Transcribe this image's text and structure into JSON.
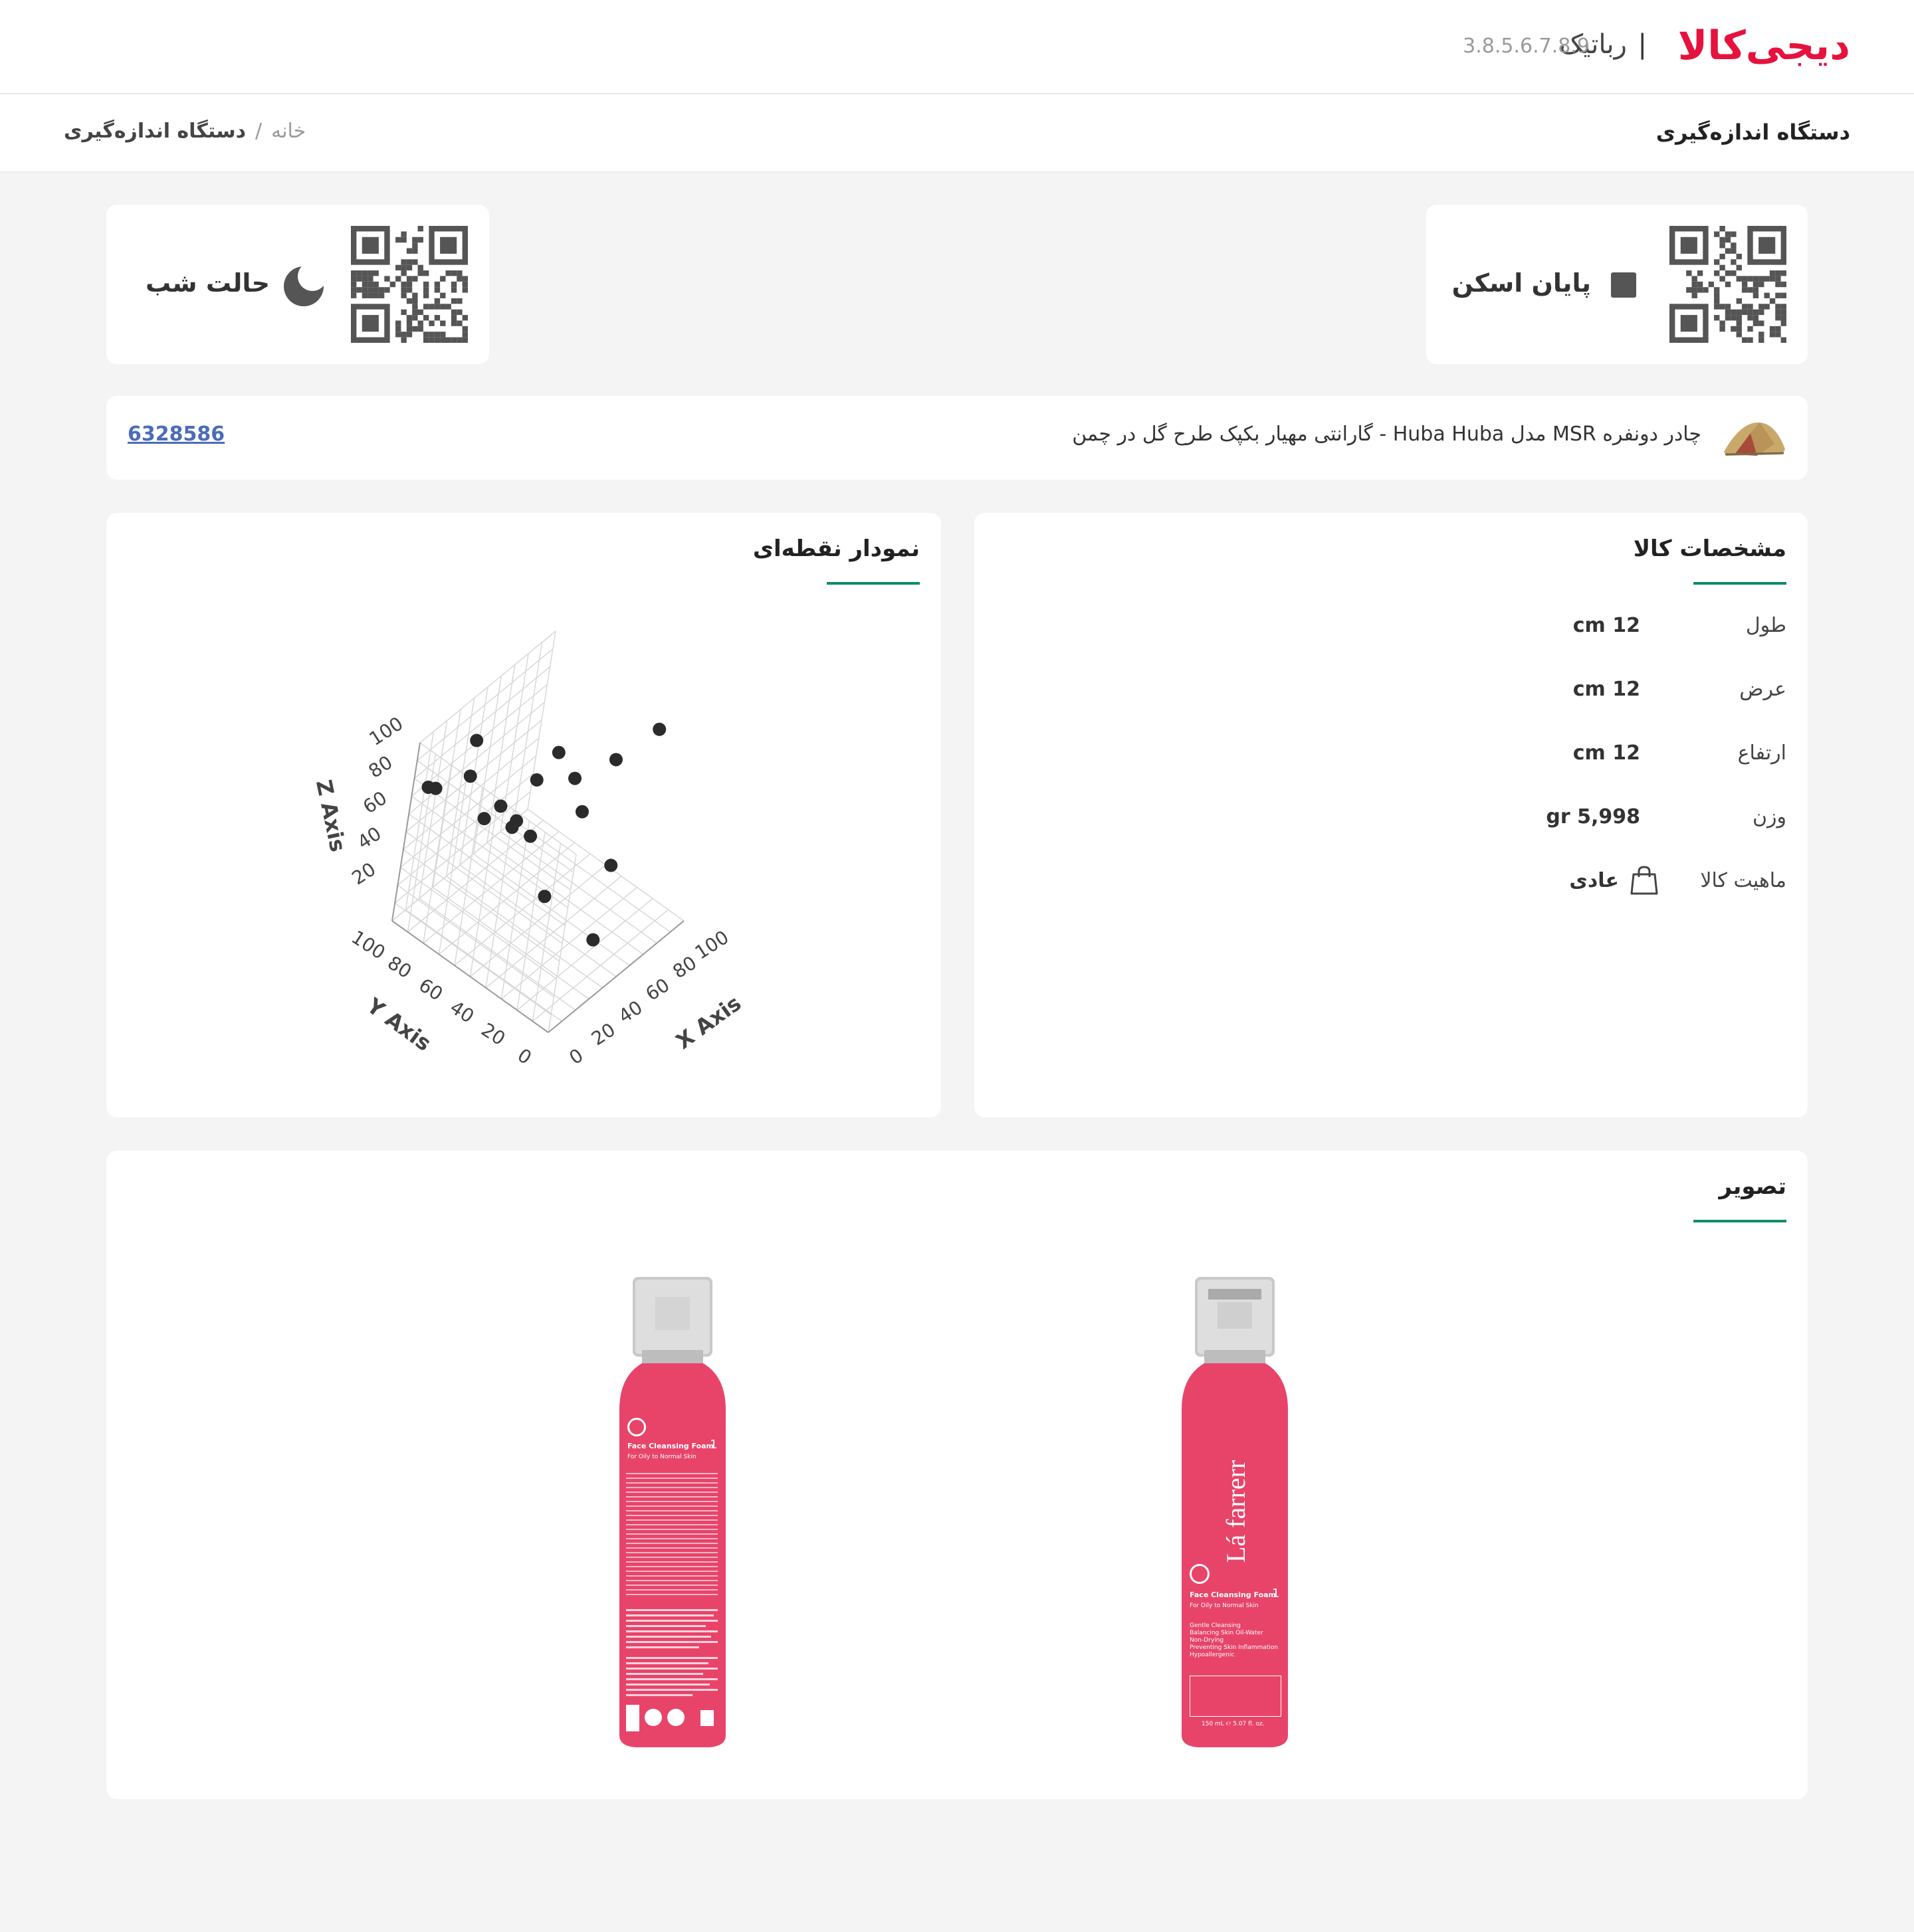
{
  "header": {
    "logo_text": "دیجی‌کالا",
    "separator": "|",
    "brand": "رباتیک",
    "version": "3.8.5.6.7.8.9"
  },
  "breadcrumb": {
    "page_title": "دستگاه اندازه‌گیری",
    "home": "خانه",
    "separator": "/",
    "current": "دستگاه اندازه‌گیری"
  },
  "actions": {
    "end_scan": "پایان اسکن",
    "night_mode": "حالت شب"
  },
  "product": {
    "title": "چادر دونفره MSR مدل Huba Huba - گارانتی مهیار بکپک طرح گل در چمن",
    "id": "6328586"
  },
  "specs": {
    "title": "مشخصات کالا",
    "rows": [
      {
        "label": "طول",
        "value": "12",
        "unit": "cm"
      },
      {
        "label": "عرض",
        "value": "12",
        "unit": "cm"
      },
      {
        "label": "ارتفاع",
        "value": "12",
        "unit": "cm"
      },
      {
        "label": "وزن",
        "value": "5,998",
        "unit": "gr"
      }
    ],
    "nature_label": "ماهیت کالا",
    "nature_value": "عادی"
  },
  "scatter": {
    "title": "نمودار نقطه‌ای"
  },
  "chart_data": {
    "type": "scatter",
    "title": "",
    "xlabel": "X Axis",
    "ylabel": "Y Axis",
    "zlabel": "Z Axis",
    "xlim": [
      0,
      100
    ],
    "ylim": [
      0,
      100
    ],
    "zlim": [
      0,
      100
    ],
    "ticks": [
      "0",
      "20",
      "40",
      "60",
      "80",
      "100"
    ],
    "grid": true,
    "points": [
      {
        "x": 98,
        "y": 30,
        "z": 90
      },
      {
        "x": 80,
        "y": 40,
        "z": 78
      },
      {
        "x": 55,
        "y": 45,
        "z": 80
      },
      {
        "x": 60,
        "y": 60,
        "z": 82
      },
      {
        "x": 45,
        "y": 60,
        "z": 76
      },
      {
        "x": 30,
        "y": 88,
        "z": 90
      },
      {
        "x": 25,
        "y": 85,
        "z": 75
      },
      {
        "x": 10,
        "y": 98,
        "z": 70
      },
      {
        "x": 12,
        "y": 95,
        "z": 70
      },
      {
        "x": 40,
        "y": 75,
        "z": 55
      },
      {
        "x": 50,
        "y": 62,
        "z": 40
      },
      {
        "x": 45,
        "y": 68,
        "z": 48
      },
      {
        "x": 35,
        "y": 80,
        "z": 48
      },
      {
        "x": 48,
        "y": 72,
        "z": 40
      },
      {
        "x": 70,
        "y": 48,
        "z": 50
      },
      {
        "x": 75,
        "y": 30,
        "z": 28
      },
      {
        "x": 45,
        "y": 45,
        "z": 20
      },
      {
        "x": 55,
        "y": 20,
        "z": 5
      }
    ]
  },
  "images": {
    "title": "تصویر",
    "bottle_front_brand": "Lá farrerr",
    "bottle_front_product": "Face Cleansing Foam",
    "bottle_front_number": "1",
    "bottle_front_sub": "For Oily to Normal Skin",
    "bottle_front_benefits": [
      "Gentle Cleansing",
      "Balancing Skin Oil-Water",
      "Non-Drying",
      "Preventing Skin Inflammation",
      "Hypoallergenic"
    ],
    "bottle_front_volume": "150 mL ℮ 5.07 fl. oz.",
    "bottle_back_product": "Face Cleansing Foam",
    "bottle_back_number": "1",
    "bottle_back_sub": "For Oily to Normal Skin"
  },
  "colors": {
    "brand": "#e6123d",
    "accent": "#0b8c6c",
    "link": "#4b6cb7",
    "bottle": "#e8446a"
  },
  "icons": {
    "end_scan": "stop-square-icon",
    "night_mode": "moon-icon",
    "nature": "shopping-bag-icon",
    "product_thumb": "tent-icon"
  }
}
